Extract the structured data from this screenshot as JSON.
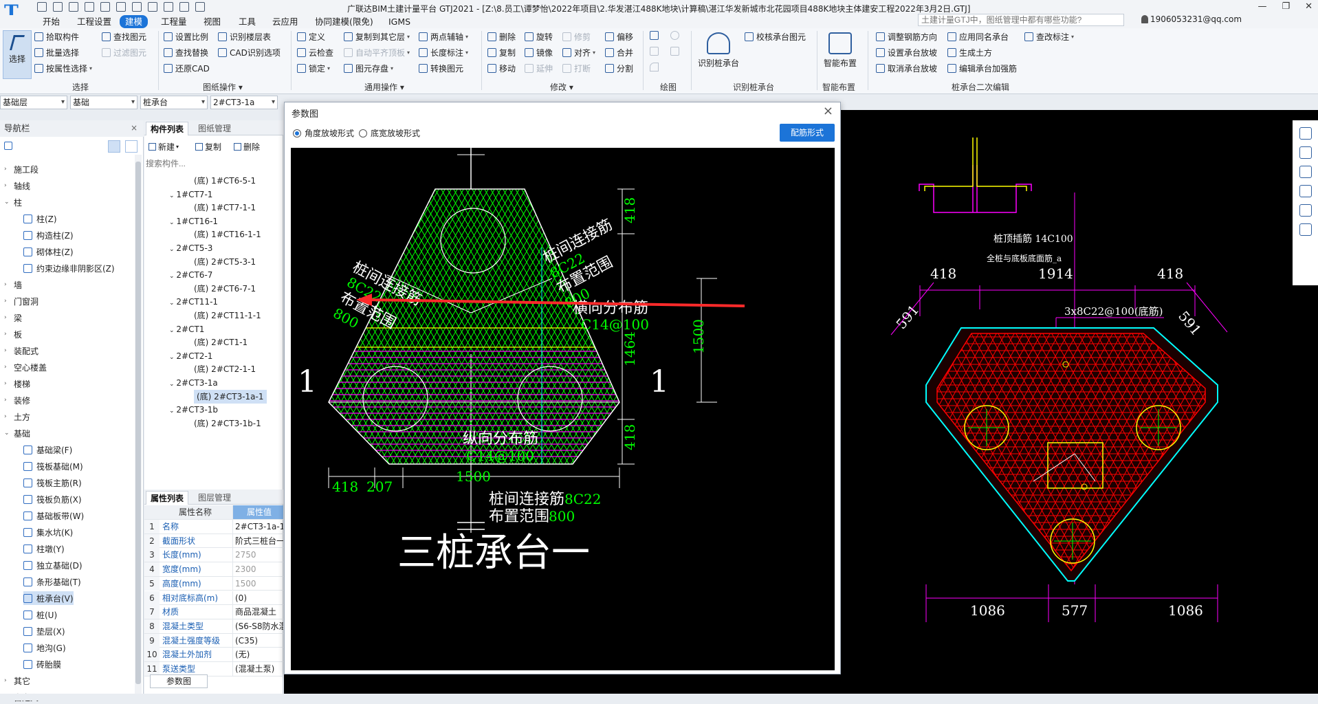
{
  "app": {
    "title": "广联达BIM土建计量平台 GTJ2021 - [Z:\\8.员工\\谭梦怡\\2022年项目\\2.华发湛江488K地块\\计算稿\\湛江华发新城市北花园项目488K地块主体建安工程2022年3月2日.GTJ]",
    "help_placeholder": "土建计量GTJ中，图纸管理中都有哪些功能?",
    "user": "1906053231@qq.com",
    "logo": "T"
  },
  "menu": {
    "tabs": [
      "开始",
      "工程设置",
      "建模",
      "工程量",
      "视图",
      "工具",
      "云应用",
      "协同建模(限免)",
      "IGMS"
    ],
    "active": "建模"
  },
  "ribbon": {
    "select": {
      "big": "选择",
      "b1": "拾取构件",
      "b2": "批量选择",
      "b3": "按属性选择",
      "b4": "查找图元",
      "b5": "过滤图元",
      "group": "选择"
    },
    "drawing": {
      "b1": "设置比例",
      "b2": "识别楼层表",
      "b3": "查找替换",
      "b4": "CAD识别选项",
      "b5": "还原CAD",
      "group": "图纸操作"
    },
    "common": {
      "b1": "定义",
      "b2": "复制到其它层",
      "b3": "两点辅轴",
      "b4": "云检查",
      "b5": "自动平齐顶板",
      "b6": "长度标注",
      "b7": "锁定",
      "b8": "图元存盘",
      "b9": "转换图元",
      "group": "通用操作"
    },
    "modify": {
      "b1": "删除",
      "b2": "旋转",
      "b3": "修剪",
      "b4": "偏移",
      "b5": "复制",
      "b6": "镜像",
      "b7": "对齐",
      "b8": "合并",
      "b9": "移动",
      "b10": "延伸",
      "b11": "打断",
      "b12": "分割",
      "group": "修改"
    },
    "draw": {
      "group": "绘图"
    },
    "recognize": {
      "big": "识别桩承台",
      "b1": "校核承台图元",
      "group": "识别桩承台"
    },
    "smart": {
      "big": "智能布置",
      "group": "智能布置"
    },
    "edit2": {
      "b1": "调整钢筋方向",
      "b2": "应用同名承台",
      "b3": "查改标注",
      "b4": "设置承台放坡",
      "b5": "生成土方",
      "b6": "取消承台放坡",
      "b7": "编辑承台加强筋",
      "group": "桩承台二次编辑"
    }
  },
  "combos": [
    "基础层",
    "基础",
    "桩承台",
    "2#CT3-1a"
  ],
  "nav": {
    "title": "导航栏",
    "items": [
      {
        "label": "施工段",
        "level": 0,
        "toggle": "›"
      },
      {
        "label": "轴线",
        "level": 0,
        "toggle": "›"
      },
      {
        "label": "柱",
        "level": 0,
        "toggle": "⌄"
      },
      {
        "label": "柱(Z)",
        "level": 1
      },
      {
        "label": "构造柱(Z)",
        "level": 1
      },
      {
        "label": "砌体柱(Z)",
        "level": 1
      },
      {
        "label": "约束边缘非阴影区(Z)",
        "level": 1
      },
      {
        "label": "墙",
        "level": 0,
        "toggle": "›"
      },
      {
        "label": "门窗洞",
        "level": 0,
        "toggle": "›"
      },
      {
        "label": "梁",
        "level": 0,
        "toggle": "›"
      },
      {
        "label": "板",
        "level": 0,
        "toggle": "›"
      },
      {
        "label": "装配式",
        "level": 0,
        "toggle": "›"
      },
      {
        "label": "空心楼盖",
        "level": 0,
        "toggle": "›"
      },
      {
        "label": "楼梯",
        "level": 0,
        "toggle": "›"
      },
      {
        "label": "装修",
        "level": 0,
        "toggle": "›"
      },
      {
        "label": "土方",
        "level": 0,
        "toggle": "›"
      },
      {
        "label": "基础",
        "level": 0,
        "toggle": "⌄"
      },
      {
        "label": "基础梁(F)",
        "level": 1
      },
      {
        "label": "筏板基础(M)",
        "level": 1
      },
      {
        "label": "筏板主筋(R)",
        "level": 1
      },
      {
        "label": "筏板负筋(X)",
        "level": 1
      },
      {
        "label": "基础板带(W)",
        "level": 1
      },
      {
        "label": "集水坑(K)",
        "level": 1
      },
      {
        "label": "柱墩(Y)",
        "level": 1
      },
      {
        "label": "独立基础(D)",
        "level": 1
      },
      {
        "label": "条形基础(T)",
        "level": 1
      },
      {
        "label": "桩承台(V)",
        "level": 1,
        "selected": true
      },
      {
        "label": "桩(U)",
        "level": 1
      },
      {
        "label": "垫层(X)",
        "level": 1
      },
      {
        "label": "地沟(G)",
        "level": 1
      },
      {
        "label": "砖胎膜",
        "level": 1
      },
      {
        "label": "其它",
        "level": 0,
        "toggle": "›"
      },
      {
        "label": "自定义",
        "level": 0,
        "toggle": "›"
      }
    ]
  },
  "components": {
    "tabs": [
      "构件列表",
      "图纸管理"
    ],
    "toolbar": [
      "新建",
      "复制",
      "删除"
    ],
    "search_placeholder": "搜索构件...",
    "items": [
      {
        "label": "(底) 1#CT6-5-1",
        "level": 2
      },
      {
        "label": "1#CT7-1",
        "level": 1
      },
      {
        "label": "(底) 1#CT7-1-1",
        "level": 2
      },
      {
        "label": "1#CT16-1",
        "level": 1
      },
      {
        "label": "(底) 1#CT16-1-1",
        "level": 2
      },
      {
        "label": "2#CT5-3",
        "level": 1
      },
      {
        "label": "(底) 2#CT5-3-1",
        "level": 2
      },
      {
        "label": "2#CT6-7",
        "level": 1
      },
      {
        "label": "(底) 2#CT6-7-1",
        "level": 2
      },
      {
        "label": "2#CT11-1",
        "level": 1
      },
      {
        "label": "(底) 2#CT11-1-1",
        "level": 2
      },
      {
        "label": "2#CT1",
        "level": 1
      },
      {
        "label": "(底) 2#CT1-1",
        "level": 2
      },
      {
        "label": "2#CT2-1",
        "level": 1
      },
      {
        "label": "(底) 2#CT2-1-1",
        "level": 2
      },
      {
        "label": "2#CT3-1a",
        "level": 1
      },
      {
        "label": "(底) 2#CT3-1a-1",
        "level": 2,
        "selected": true
      },
      {
        "label": "2#CT3-1b",
        "level": 1
      },
      {
        "label": "(底) 2#CT3-1b-1",
        "level": 2
      }
    ]
  },
  "properties": {
    "tabs": [
      "属性列表",
      "图层管理"
    ],
    "header": {
      "name": "属性名称",
      "value": "属性值"
    },
    "rows": [
      {
        "n": "1",
        "k": "名称",
        "v": "2#CT3-1a-1",
        "gray": false
      },
      {
        "n": "2",
        "k": "截面形状",
        "v": "阶式三桩台一",
        "gray": false
      },
      {
        "n": "3",
        "k": "长度(mm)",
        "v": "2750",
        "gray": true
      },
      {
        "n": "4",
        "k": "宽度(mm)",
        "v": "2300",
        "gray": true
      },
      {
        "n": "5",
        "k": "高度(mm)",
        "v": "1500",
        "gray": true
      },
      {
        "n": "6",
        "k": "相对底标高(m)",
        "v": "(0)",
        "gray": false
      },
      {
        "n": "7",
        "k": "材质",
        "v": "商品混凝土",
        "gray": false
      },
      {
        "n": "8",
        "k": "混凝土类型",
        "v": "(S6-S8防水混",
        "gray": false
      },
      {
        "n": "9",
        "k": "混凝土强度等级",
        "v": "(C35)",
        "gray": false
      },
      {
        "n": "10",
        "k": "混凝土外加剂",
        "v": "(无)",
        "gray": false
      },
      {
        "n": "11",
        "k": "泵送类型",
        "v": "(混凝土泵)",
        "gray": false
      }
    ],
    "bottom_tab": "参数图"
  },
  "dialog": {
    "title": "参数图",
    "close": "×",
    "radio1": "角度放坡形式",
    "radio2": "底宽放坡形式",
    "button": "配筋形式",
    "drawing": {
      "link_bar_l1": "桩间连接筋",
      "link_bar_l2": "8C22",
      "range_l1": "布置范围",
      "range_l2": "800",
      "link_bar_r1": "桩间连接筋",
      "link_bar_r2": "8C22",
      "range_r1": "布置范围",
      "range_r2": "800",
      "transverse": "横向分布筋",
      "transverse_val": "C14@100",
      "longitudinal": "纵向分布筋",
      "longitudinal_val": "C14@100",
      "bottom_link": "桩间连接筋",
      "bottom_link_val": "8C22",
      "bottom_range": "布置范围",
      "bottom_range_val": "800",
      "title": "三桩承台一",
      "dim_418_top": "418",
      "dim_1464": "1464",
      "dim_418_bot": "418",
      "dim_1500_v": "1500",
      "dim_418_h": "418",
      "dim_207": "207",
      "dim_1500_h": "1500",
      "section_l": "1",
      "section_r": "1"
    }
  },
  "cad": {
    "note1": "桩顶插筋 14C100",
    "note2": "全桩与底板底面筋_a",
    "dim_418_l": "418",
    "dim_1914": "1914",
    "dim_418_r": "418",
    "rebar": "3x8C22@100(底筋)",
    "dim_591_l": "591",
    "dim_591_r": "591",
    "dim_1086_l": "1086",
    "dim_577": "577",
    "dim_1086_r": "1086"
  },
  "colors": {
    "accent": "#1c74d8",
    "cad_bg": "#000000",
    "hatch": "#00ff00",
    "cad_red": "#ff0000",
    "cad_cyan": "#00ffff",
    "cad_magenta": "#ff00ff",
    "cad_yellow": "#ffff00",
    "arrow": "#ff2a2a"
  }
}
